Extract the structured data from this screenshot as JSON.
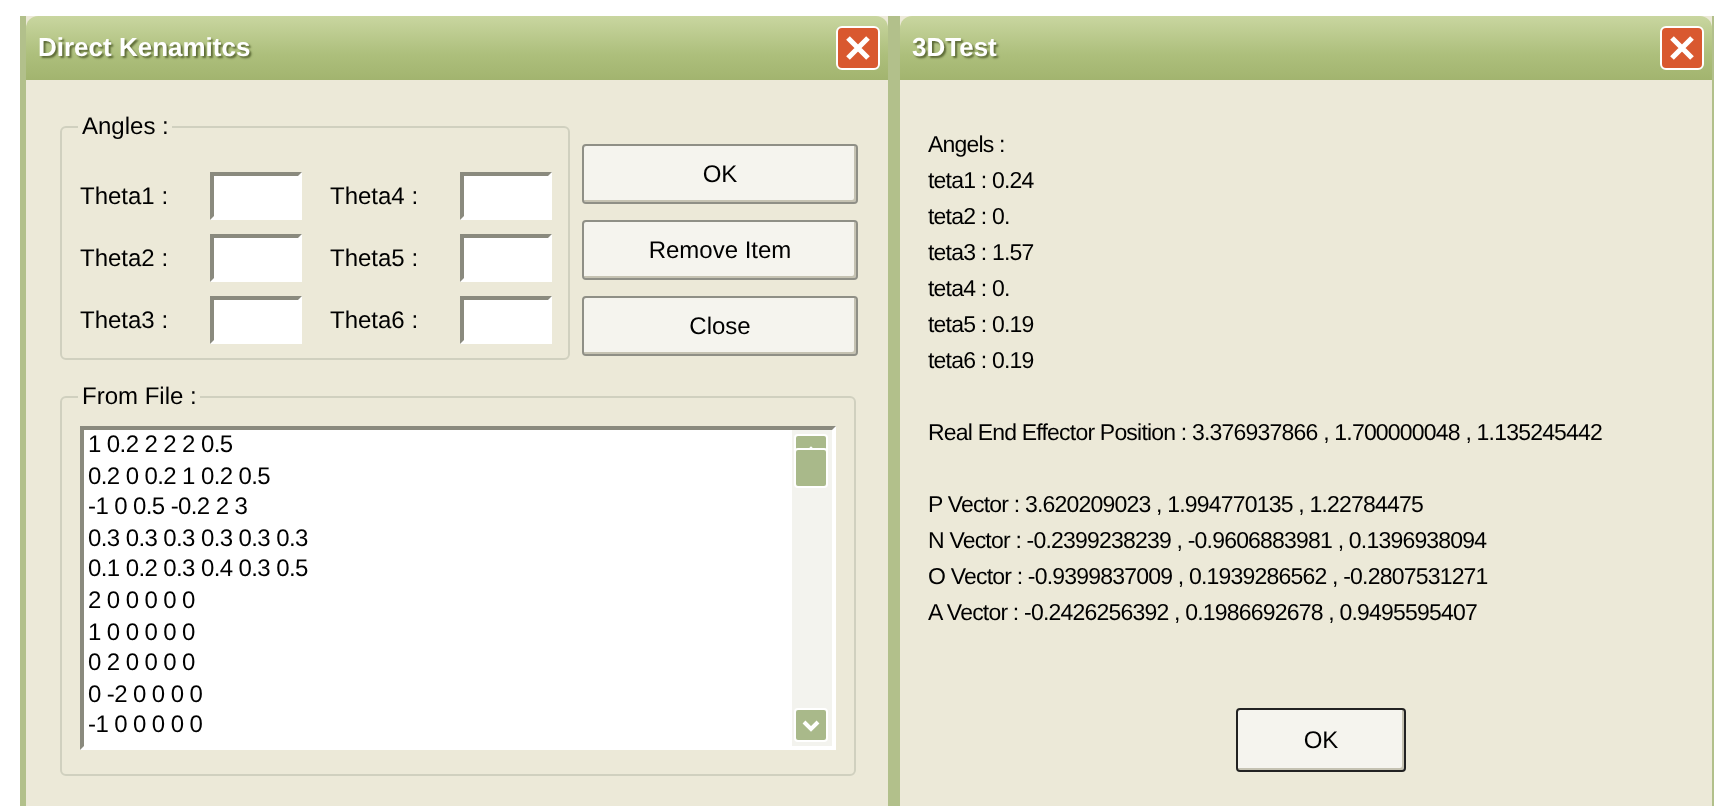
{
  "kinematics_dialog": {
    "title": "Direct Kenamitcs",
    "angles_group": {
      "label": "Angles :",
      "fields": [
        {
          "label": "Theta1 :"
        },
        {
          "label": "Theta2 :"
        },
        {
          "label": "Theta3 :"
        },
        {
          "label": "Theta4 :"
        },
        {
          "label": "Theta5 :"
        },
        {
          "label": "Theta6 :"
        }
      ]
    },
    "buttons": [
      "OK",
      "Remove Item",
      "Close"
    ],
    "file_group": {
      "label": "From File :",
      "items": [
        "1 0.2 2 2 2 0.5",
        "0.2 0 0.2 1 0.2 0.5",
        "-1 0 0.5 -0.2 2 3",
        "0.3 0.3 0.3 0.3 0.3 0.3",
        "0.1 0.2 0.3 0.4 0.3 0.5",
        "2 0 0 0 0 0",
        "1 0 0 0 0 0",
        "0 2 0 0 0 0",
        "0 -2 0 0 0 0",
        "-1 0 0 0 0 0"
      ]
    }
  },
  "result_dialog": {
    "title": "3DTest",
    "sections": [
      [
        "Angels :",
        "teta1 : 0.24",
        "teta2 : 0.",
        "teta3 : 1.57",
        "teta4 : 0.",
        "teta5 : 0.19",
        "teta6 : 0.19"
      ],
      [
        "Real End Effector Position : 3.376937866 , 1.700000048 , 1.135245442"
      ],
      [
        "P Vector : 3.620209023 , 1.994770135 , 1.22784475",
        "N Vector : -0.2399238239 , -0.9606883981 , 0.1396938094",
        "O Vector : -0.9399837009 , 0.1939286562 , -0.2807531271",
        "A Vector : -0.2426256392 , 0.1986692678 , 0.9495595407"
      ]
    ],
    "button": "OK"
  }
}
